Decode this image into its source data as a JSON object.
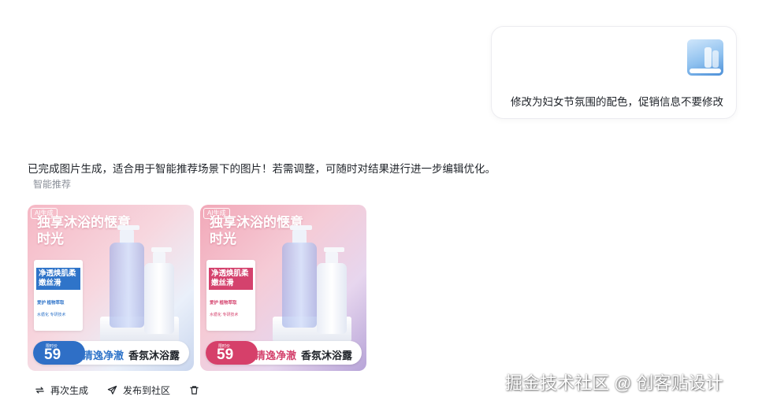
{
  "user_message": {
    "text": "修改为妇女节氛围的配色，促销信息不要修改"
  },
  "assistant_reply": {
    "text": "已完成图片生成，适合用于智能推荐场景下的图片！若需调整，可随时对结果进行进一步编辑优化。",
    "tag": "智能推荐"
  },
  "images": [
    {
      "badge": "AI生成",
      "headline": "独享沐浴的惬意时光",
      "feature": "净透焕肌柔嫩丝滑",
      "info1": "爱护 植物萃取",
      "info2": "水循化 专研技术",
      "price": "59",
      "price_label": "限时价",
      "slogan": "清逸净澈",
      "product": "香氛沐浴露",
      "accent": "#2f74c9"
    },
    {
      "badge": "AI生成",
      "headline": "独享沐浴的惬意时光",
      "feature": "净透焕肌柔嫩丝滑",
      "info1": "爱护 植物萃取",
      "info2": "水循化 专研技术",
      "price": "59",
      "price_label": "限时价",
      "slogan": "清逸净澈",
      "product": "香氛沐浴露",
      "accent": "#d4426d"
    }
  ],
  "actions": {
    "regenerate": "再次生成",
    "publish": "发布到社区",
    "delete_icon": "trash-icon",
    "regenerate_icon": "repeat-icon",
    "publish_icon": "send-icon"
  },
  "watermark": "掘金技术社区 @ 创客贴设计"
}
